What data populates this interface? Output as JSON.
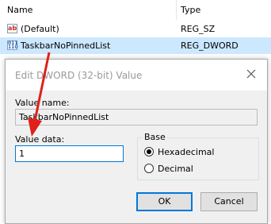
{
  "registry": {
    "columns": {
      "name": "Name",
      "type": "Type"
    },
    "rows": [
      {
        "icon": "string-value-icon",
        "icon_text": "ab",
        "name": "(Default)",
        "type": "REG_SZ"
      },
      {
        "icon": "binary-value-icon",
        "icon_text": "011 110",
        "name": "TaskbarNoPinnedList",
        "type": "REG_DWORD"
      }
    ]
  },
  "dialog": {
    "title": "Edit DWORD (32-bit) Value",
    "value_name_label": "Value name:",
    "value_name": "TaskbarNoPinnedList",
    "value_data_label": "Value data:",
    "value_data": "1",
    "base_label": "Base",
    "hex_label": "Hexadecimal",
    "decimal_label": "Decimal",
    "selected_base": "Hexadecimal",
    "ok_label": "OK",
    "cancel_label": "Cancel"
  },
  "colors": {
    "selection": "#cce8ff",
    "annotation_arrow": "#e0201b",
    "focus_border": "#0078d7"
  }
}
